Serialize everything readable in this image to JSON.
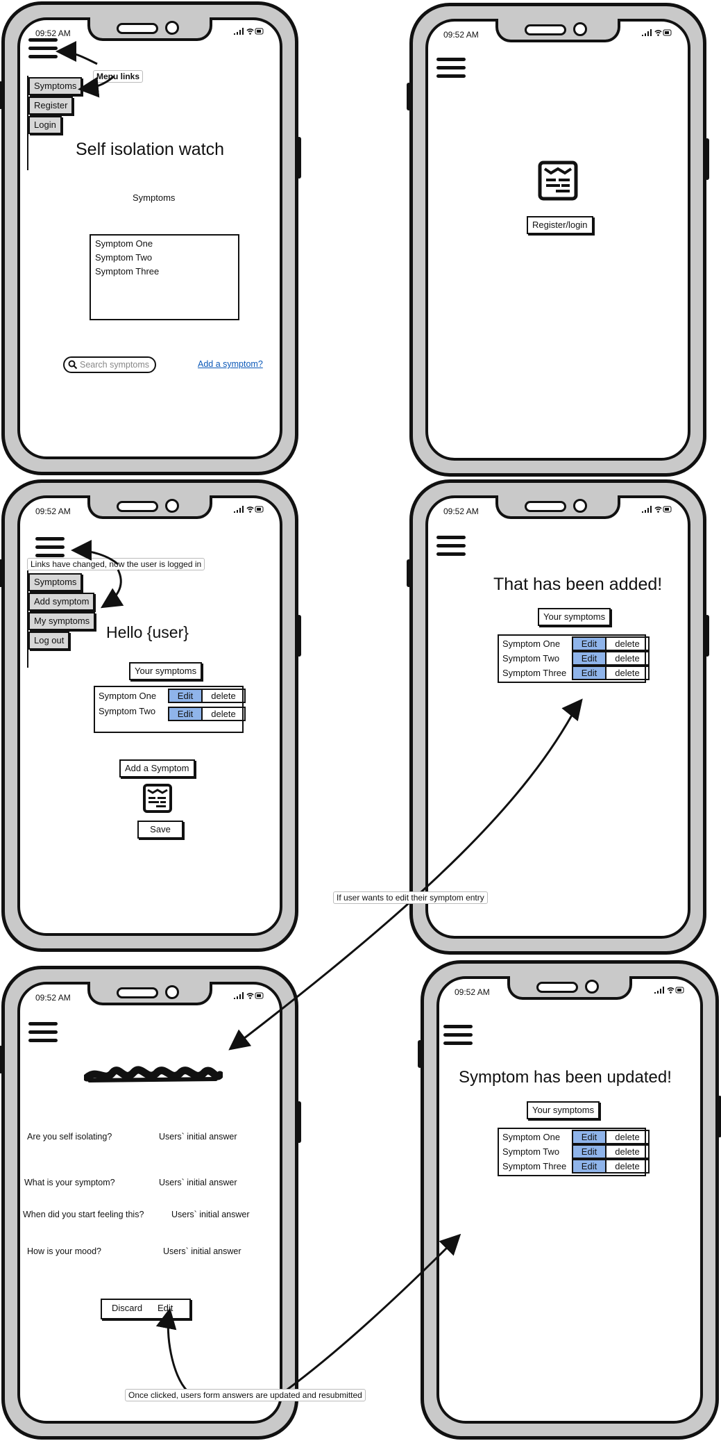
{
  "status_time": "09:52 AM",
  "screen1": {
    "menu": [
      "Symptoms",
      "Register",
      "Login"
    ],
    "annotation": "Menu links",
    "title": "Self isolation watch",
    "subtitle": "Symptoms",
    "list": [
      "Symptom One",
      "Symptom Two",
      "Symptom  Three"
    ],
    "search_placeholder": "Search symptoms",
    "add_link": "Add a symptom?"
  },
  "screen2": {
    "button": "Register/login"
  },
  "screen3": {
    "annotation": "Links have changed, now the user is logged in",
    "menu": [
      "Symptoms",
      "Add symptom",
      "My symptoms",
      "Log out"
    ],
    "title": "Hello {user}",
    "your_symptoms": "Your symptoms",
    "rows": [
      {
        "name": "Symptom One",
        "edit": "Edit",
        "delete": "delete"
      },
      {
        "name": "Symptom Two",
        "edit": "Edit",
        "delete": "delete"
      }
    ],
    "add_button": "Add a Symptom",
    "save": "Save"
  },
  "screen4": {
    "title": "That has been added!",
    "your_symptoms": "Your symptoms",
    "rows": [
      {
        "name": "Symptom One",
        "edit": "Edit",
        "delete": "delete"
      },
      {
        "name": "Symptom Two",
        "edit": "Edit",
        "delete": "delete"
      },
      {
        "name": "Symptom Three",
        "edit": "Edit",
        "delete": "delete"
      }
    ]
  },
  "middle_annotation": "If user wants to edit their symptom entry",
  "screen5": {
    "questions": [
      {
        "q": "Are you self isolating?",
        "a": "Users` initial answer"
      },
      {
        "q": "What is your symptom?",
        "a": "Users` initial answer"
      },
      {
        "q": "When did you start feeling this?",
        "a": "Users` initial answer"
      },
      {
        "q": "How is your mood?",
        "a": "Users` initial answer"
      }
    ],
    "discard": "Discard",
    "edit": "Edit",
    "annotation": "Once clicked, users form answers are updated and resubmitted"
  },
  "screen6": {
    "title": "Symptom has been updated!",
    "your_symptoms": "Your symptoms",
    "rows": [
      {
        "name": "Symptom One",
        "edit": "Edit",
        "delete": "delete"
      },
      {
        "name": "Symptom Two",
        "edit": "Edit",
        "delete": "delete"
      },
      {
        "name": "Symptom Three",
        "edit": "Edit",
        "delete": "delete"
      }
    ]
  }
}
